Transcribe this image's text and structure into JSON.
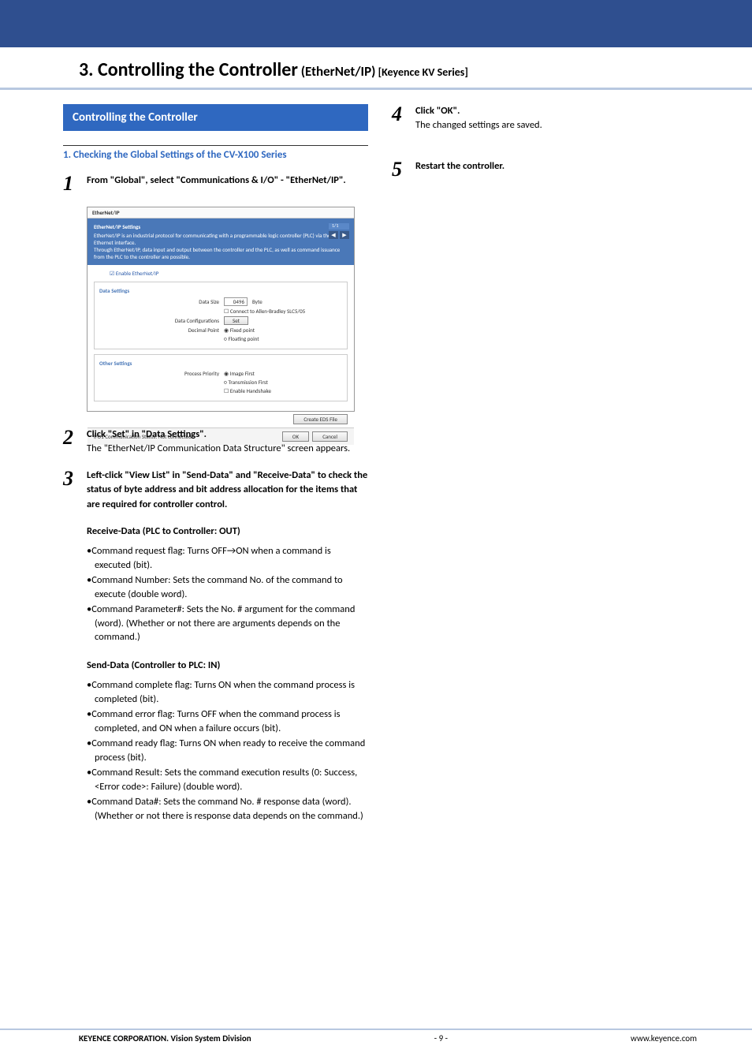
{
  "header": {
    "title_num": "3. Controlling the Controller",
    "title_sub": " (EtherNet/IP)",
    "title_sub2": " [Keyence KV Series]"
  },
  "left": {
    "banner": "Controlling the Controller",
    "subheading": "1. Checking the Global Settings of the CV-X100 Series",
    "step1_lead": "From \"Global\", select \"Communications & I/O\" - \"EtherNet/IP\".",
    "step2_lead": "Click \"Set\" in \"Data Settings\".",
    "step2_desc": "The \"EtherNet/IP Communication Data Structure\" screen appears.",
    "step3_lead": "Left-click \"View List\" in \"Send-Data\" and \"Receive-Data\" to check the status of byte address and bit address allocation for the items that are required for controller control.",
    "recv_h": "Receive-Data (PLC to Controller: OUT)",
    "recv": [
      "•Command request flag: Turns OFF→ON when a command is executed (bit).",
      "•Command Number: Sets the command No. of the command to execute (double word).",
      "•Command Parameter#: Sets the No. # argument for the command (word). (Whether or not there are arguments depends on the command.)"
    ],
    "send_h": "Send-Data (Controller to PLC: IN)",
    "send": [
      "•Command complete flag: Turns ON when the command process is completed (bit).",
      "•Command error flag: Turns OFF when the command process is completed, and ON when a failure occurs (bit).",
      "•Command ready flag: Turns ON when ready to receive the command process (bit).",
      "•Command Result: Sets the command execution results (0: Success, <Error code>: Failure) (double word).",
      "•Command Data#: Sets the command No. # response data (word). (Whether or not there is response data depends on the command.)"
    ]
  },
  "right": {
    "step4_lead": "Click \"OK\".",
    "step4_desc": "The changed settings are saved.",
    "step5_lead": "Restart the controller."
  },
  "screenshot": {
    "title": "EtherNet/IP",
    "blue_head": "EtherNet/IP Settings",
    "blue_line1": "EtherNet/IP is an industrial protocol for communicating with a programmable logic controller (PLC) via the Ethernet interface.",
    "blue_line2": "Through EtherNet/IP, data input and output between the controller and the PLC, as well as command issuance from the PLC to the controller are possible.",
    "nav_count": "1/1",
    "enable": "Enable EtherNet/IP",
    "data_settings": "Data Settings",
    "data_size": "Data Size",
    "data_size_val": "0496",
    "data_size_unit": "Byte",
    "ab_check": "Connect to Allen-Bradley SLC5/05",
    "data_config": "Data Configurations",
    "set_btn": "Set",
    "dec_point": "Decimal Point",
    "fixed": "Fixed point",
    "floating": "Floating point",
    "other_settings": "Other Settings",
    "process_priority": "Process Priority",
    "image_first": "Image First",
    "trans_first": "Transmission First",
    "enable_hs": "Enable Handshake",
    "create_eds": "Create EDS File",
    "status": "I/O1 Communication Status: Not connected",
    "ok": "OK",
    "cancel": "Cancel"
  },
  "footer": {
    "left": "KEYENCE CORPORATION. Vision System Division",
    "center": "- 9 -",
    "right": "www.keyence.com"
  }
}
